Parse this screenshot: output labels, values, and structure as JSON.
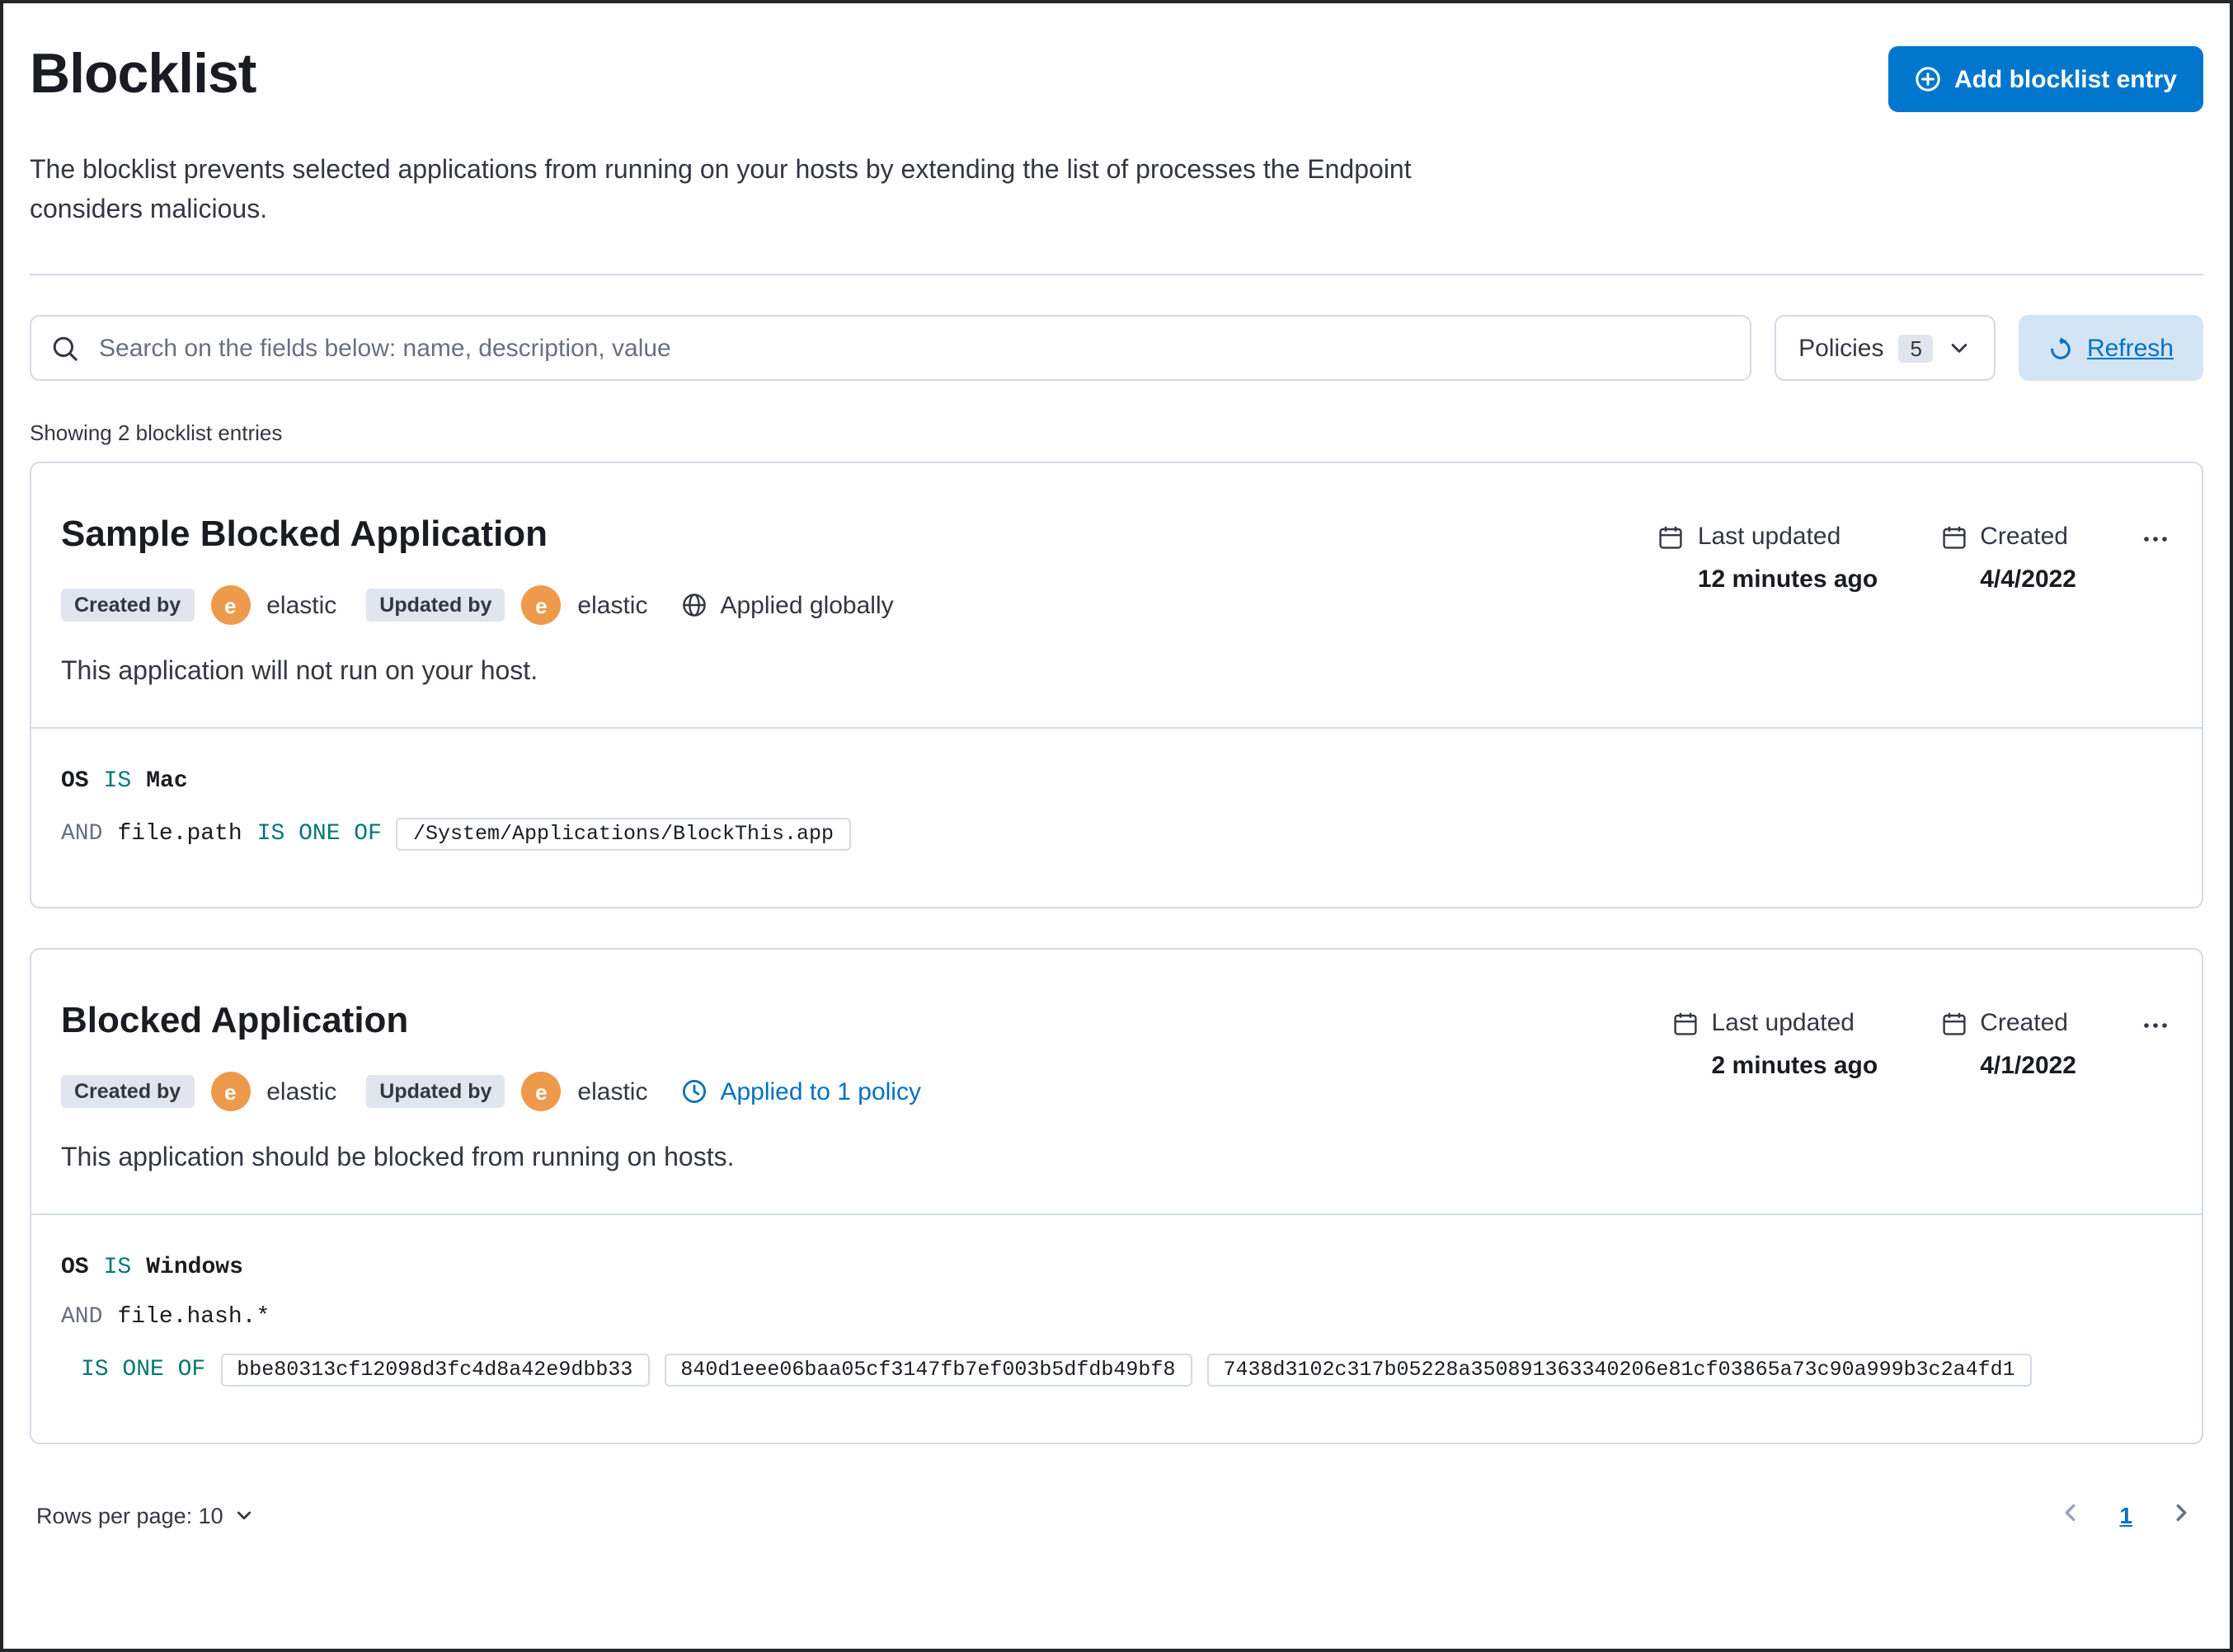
{
  "colors": {
    "primary_button": "#0077CC",
    "link": "#0071C2",
    "operator": "#007871",
    "avatar": "#EE9A4D"
  },
  "header": {
    "title": "Blocklist",
    "description": "The blocklist prevents selected applications from running on your hosts by extending the list of processes the Endpoint considers malicious.",
    "add_button_label": "Add blocklist entry"
  },
  "toolbar": {
    "search_placeholder": "Search on the fields below: name, description, value",
    "policies_label": "Policies",
    "policies_count": "5",
    "refresh_label": "Refresh"
  },
  "summary_text": "Showing 2 blocklist entries",
  "entries": [
    {
      "title": "Sample Blocked Application",
      "created_by_label": "Created by",
      "created_by_user": "elastic",
      "updated_by_label": "Updated by",
      "updated_by_user": "elastic",
      "avatar_initial": "e",
      "scope_label": "Applied globally",
      "last_updated_label": "Last updated",
      "last_updated_value": "12 minutes ago",
      "created_label": "Created",
      "created_value": "4/4/2022",
      "description": "This application will not run on your host.",
      "criteria": {
        "os_field": "OS",
        "os_operator": "IS",
        "os_value": "Mac",
        "conjunction": "AND",
        "field": "file.path",
        "operator": "IS ONE OF",
        "values": [
          "/System/Applications/BlockThis.app"
        ]
      }
    },
    {
      "title": "Blocked Application",
      "created_by_label": "Created by",
      "created_by_user": "elastic",
      "updated_by_label": "Updated by",
      "updated_by_user": "elastic",
      "avatar_initial": "e",
      "scope_label": "Applied to 1 policy",
      "last_updated_label": "Last updated",
      "last_updated_value": "2 minutes ago",
      "created_label": "Created",
      "created_value": "4/1/2022",
      "description": "This application should be blocked from running on hosts.",
      "criteria": {
        "os_field": "OS",
        "os_operator": "IS",
        "os_value": "Windows",
        "conjunction": "AND",
        "field": "file.hash.*",
        "operator": "IS ONE OF",
        "values": [
          "bbe80313cf12098d3fc4d8a42e9dbb33",
          "840d1eee06baa05cf3147fb7ef003b5dfdb49bf8",
          "7438d3102c317b05228a350891363340206e81cf03865a73c90a999b3c2a4fd1"
        ]
      }
    }
  ],
  "footer": {
    "rows_per_page_label": "Rows per page: 10",
    "current_page": "1"
  }
}
